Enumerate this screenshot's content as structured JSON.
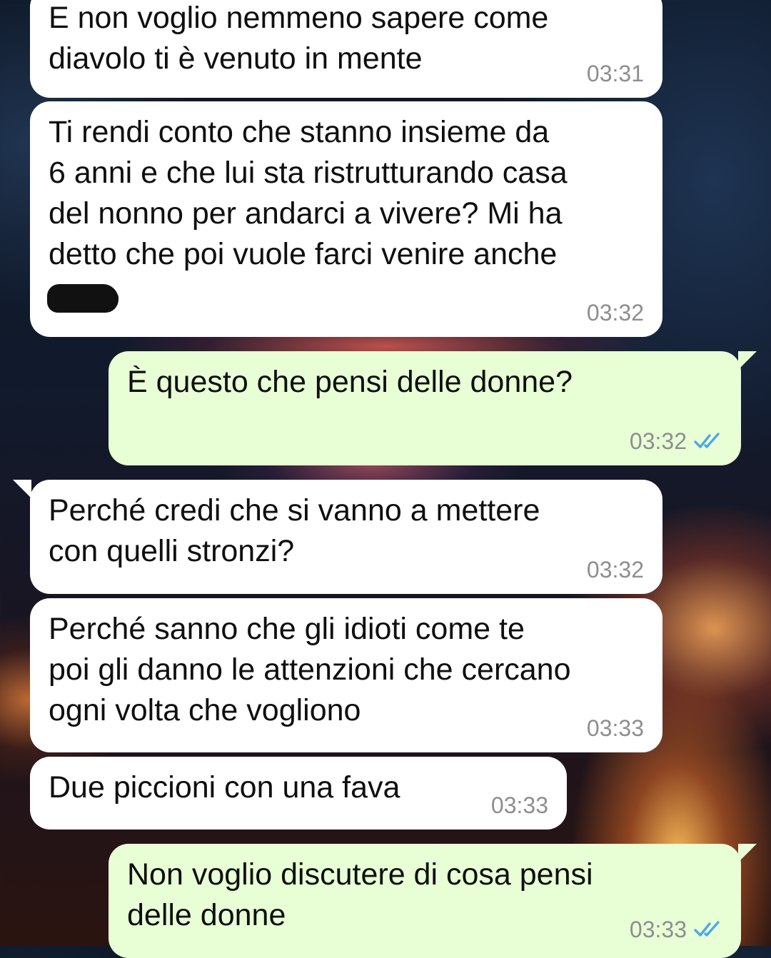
{
  "messages": [
    {
      "direction": "in",
      "text": "E non voglio nemmeno sapere come\ndiavolo ti è venuto in mente",
      "time": "03:31"
    },
    {
      "direction": "in",
      "text": "Ti rendi conto che stanno insieme da\n6 anni e che lui sta ristrutturando casa\ndel nonno per andarci a vivere? Mi ha\ndetto che poi vuole farci venire anche",
      "time": "03:32",
      "redacted_content": true
    },
    {
      "direction": "out",
      "text": "È questo che pensi delle donne?",
      "time": "03:32",
      "status": "read"
    },
    {
      "direction": "in",
      "text": "Perché credi che si vanno a mettere\ncon quelli stronzi?",
      "time": "03:32"
    },
    {
      "direction": "in",
      "text": "Perché sanno che gli idioti come te\npoi gli danno le attenzioni che cercano\nogni volta che vogliono",
      "time": "03:33"
    },
    {
      "direction": "in",
      "text": "Due piccioni con una fava",
      "time": "03:33"
    },
    {
      "direction": "out",
      "text": "Non voglio discutere di cosa pensi\ndelle donne",
      "time": "03:33",
      "status": "read"
    }
  ],
  "colors": {
    "incoming_bubble": "#ffffff",
    "outgoing_bubble": "#e8ffd6",
    "timestamp": "#8e8e8e",
    "read_check": "#4fa8e8"
  },
  "icons": {
    "read_receipt": "double-check-icon"
  }
}
